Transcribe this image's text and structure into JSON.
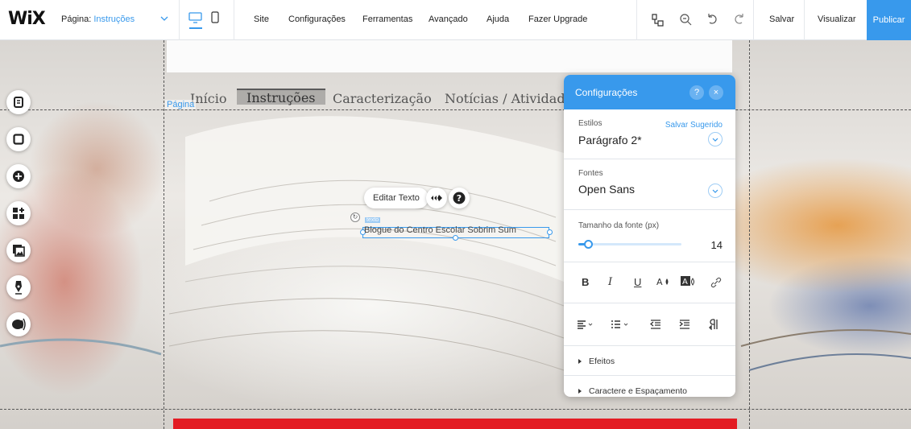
{
  "brand": {
    "logo": "WiX",
    "accent": "#3899ec",
    "publish_color": "#3899ec"
  },
  "topbar": {
    "page_prefix": "Página:",
    "page_name": "Instruções",
    "menu": {
      "site": "Site",
      "configuracoes": "Configurações",
      "ferramentas": "Ferramentas",
      "avancado": "Avançado",
      "ajuda": "Ajuda",
      "upgrade": "Fazer Upgrade"
    },
    "save": "Salvar",
    "preview": "Visualizar",
    "publish": "Publicar",
    "icons": [
      "desktop-icon",
      "mobile-icon",
      "layers-icon",
      "zoom-icon",
      "undo-icon",
      "redo-icon"
    ]
  },
  "site": {
    "nav": {
      "inicio": "Início",
      "instrucoes": "Instruções",
      "caracterizacao": "Caracterização",
      "noticias": "Notícias / Atividades"
    },
    "page_tag": "Página",
    "selected_text": "Blogue do Centro Escolar Sobrim Sum",
    "element_label": "texto",
    "edit_text_button": "Editar Texto",
    "band_color": "#e31c23"
  },
  "left_toolbar": [
    "menus-pages-icon",
    "background-icon",
    "add-icon",
    "app-market-icon",
    "media-icon",
    "pen-icon",
    "blog-icon"
  ],
  "settings_panel": {
    "title": "Configurações",
    "help": "?",
    "close": "×",
    "styles": {
      "label": "Estilos",
      "link": "Salvar Sugerido",
      "value": "Parágrafo 2*"
    },
    "fonts": {
      "label": "Fontes",
      "value": "Open Sans"
    },
    "font_size": {
      "label": "Tamanho da fonte (px)",
      "value": "14",
      "slider_fraction": 0.09
    },
    "format": {
      "bold": "B",
      "italic": "I",
      "underline": "U"
    },
    "effects": "Efeitos",
    "char_spacing": "Caractere e Espaçamento"
  }
}
